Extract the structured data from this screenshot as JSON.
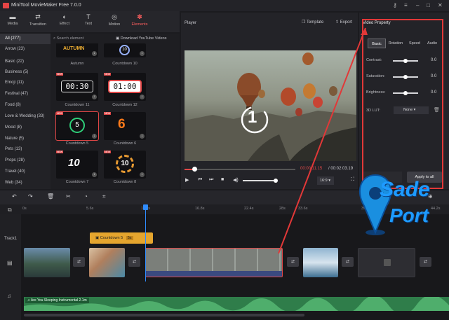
{
  "app": {
    "title": "MiniTool MovieMaker Free 7.0.0"
  },
  "toolbar": {
    "items": [
      "Media",
      "Transition",
      "Effect",
      "Text",
      "Motion",
      "Elements"
    ],
    "active": "Elements"
  },
  "categories": [
    "All (277)",
    "Arrow (23)",
    "Basic (22)",
    "Business (5)",
    "Emoji (11)",
    "Festival (47)",
    "Food (8)",
    "Love & Wedding (33)",
    "Mood (8)",
    "Nature (5)",
    "Pets (13)",
    "Props (28)",
    "Travel (40)",
    "Web (34)"
  ],
  "library": {
    "search_placeholder": "Search element",
    "download_label": "Download YouTube Videos",
    "items": [
      {
        "label": "Autumn",
        "display": "AUTUMN"
      },
      {
        "label": "Countdown 10",
        "display": "10"
      },
      {
        "label": "Countdown 11",
        "display": "00:30"
      },
      {
        "label": "Countdown 12",
        "display": "01:00"
      },
      {
        "label": "Countdown 5",
        "display": "5"
      },
      {
        "label": "Countdown 6",
        "display": "6"
      },
      {
        "label": "Countdown 7",
        "display": "10"
      },
      {
        "label": "Countdown 8",
        "display": "10"
      }
    ],
    "new_badge": "NEW"
  },
  "player": {
    "title": "Player",
    "template_label": "Template",
    "export_label": "Export",
    "overlay_number": "1",
    "time_current": "00:00:11.15",
    "time_total": "/ 00:02:03.19",
    "aspect": "16:9",
    "progress": 0.09
  },
  "video_property": {
    "title": "Video Property",
    "tabs": [
      "Basic",
      "Rotation",
      "Speed",
      "Audio"
    ],
    "active_tab": "Basic",
    "rows": [
      {
        "label": "Contrast:",
        "value": "0.0",
        "level": 0.5
      },
      {
        "label": "Saturation:",
        "value": "0.0",
        "level": 0.5
      },
      {
        "label": "Brightness:",
        "value": "0.0",
        "level": 0.5
      }
    ],
    "lut_label": "3D LUT:",
    "lut_value": "None",
    "apply_label": "Apply to all"
  },
  "timeline": {
    "ruler": [
      "0s",
      "5.6s",
      "11.2s",
      "16.8s",
      "22.4s",
      "28s",
      "33.6s",
      "39.2s",
      "44.2s"
    ],
    "track1_label": "Track1",
    "element_clip": "Countdown 5",
    "element_duration": "5s",
    "audio_clip": "Are You Sleeping Instrumental",
    "audio_duration": "2.1m"
  },
  "watermark": {
    "line1": "Sade",
    "line2": "Port"
  },
  "colors": {
    "accent": "#e14848",
    "playhead": "#2f8cff",
    "element_clip": "#e5a52e",
    "audio": "#2f7d4a"
  }
}
